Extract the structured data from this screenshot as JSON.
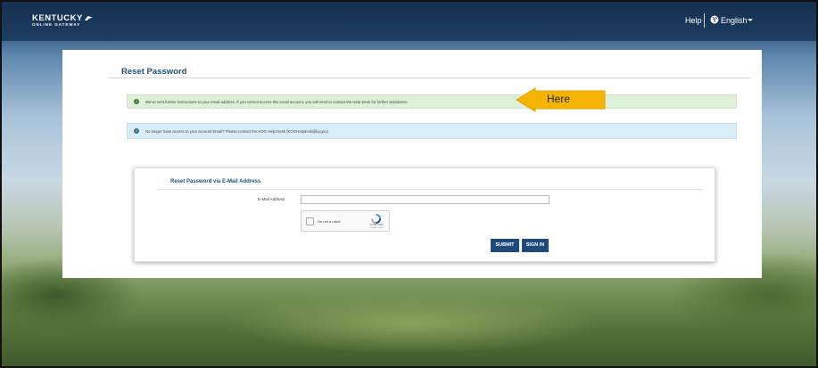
{
  "header": {
    "logo_line1": "KENTUCKY",
    "logo_line2": "ONLINE GATEWAY",
    "help_label": "Help",
    "language_label": "English"
  },
  "page": {
    "title": "Reset Password"
  },
  "alerts": {
    "success": "We've sent further instructions to your email address. If you cannot access this email account, you will need to contact the Help Desk for further assistance.",
    "info": "No longer have access to your account Email? Please contact the KOG Help Desk (KOGHelpdesk@ky.gov)"
  },
  "callout": {
    "text": "Here",
    "color": "#f5b400"
  },
  "form": {
    "title": "Reset Password via E-Mail Address",
    "email_label": "E-Mail Address",
    "email_value": "",
    "recaptcha_label": "I'm not a robot",
    "recaptcha_brand": "reCAPTCHA",
    "recaptcha_terms": "Privacy - Terms",
    "submit_label": "SUBMIT",
    "signin_label": "SIGN IN"
  },
  "colors": {
    "header_bg": "#153050",
    "brand_blue": "#1e4a7b",
    "success_bg": "#dff0d8",
    "info_bg": "#d9edf7"
  },
  "icons": {
    "success": "check-circle-icon",
    "info": "info-circle-icon",
    "language": "globe-icon"
  }
}
